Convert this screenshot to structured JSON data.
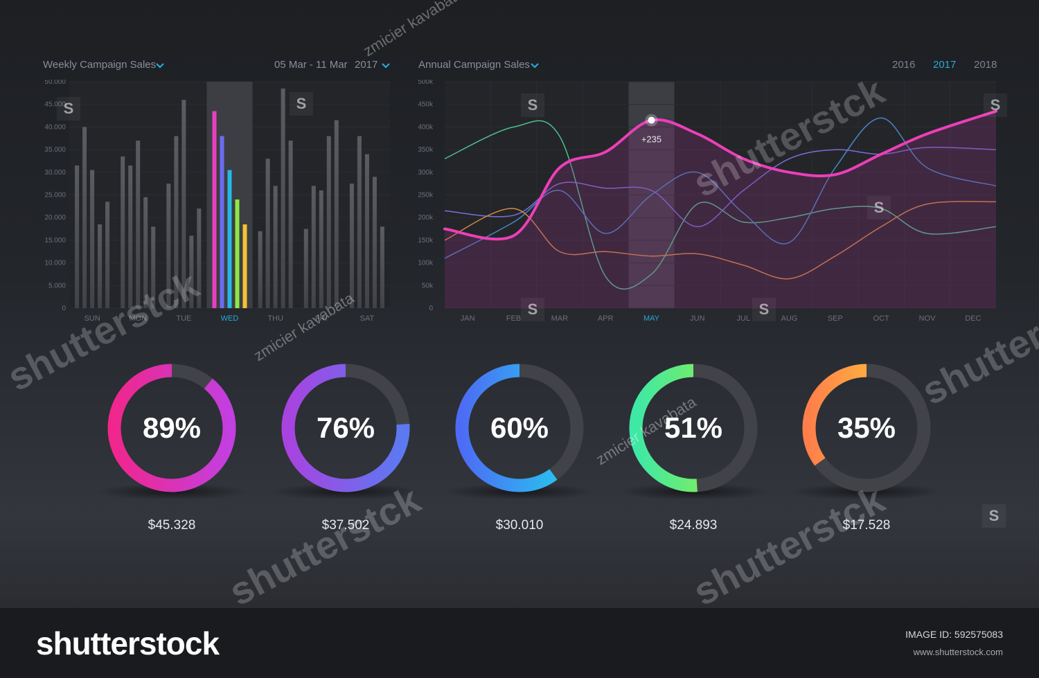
{
  "weekly": {
    "title": "Weekly Campaign Sales",
    "date_range": "05 Mar - 11 Mar",
    "year": "2017"
  },
  "annual": {
    "title": "Annual Campaign Sales",
    "years": [
      "2016",
      "2017",
      "2018"
    ],
    "active_year": "2017",
    "tooltip": "+235"
  },
  "chart_data": [
    {
      "type": "bar",
      "title": "Weekly Campaign Sales",
      "categories": [
        "SUN",
        "MON",
        "TUE",
        "WED",
        "THU",
        "FRI",
        "SAT"
      ],
      "highlighted_category": "WED",
      "yticks": [
        "0",
        "5.000",
        "10.000",
        "15.000",
        "20.000",
        "25.000",
        "30.000",
        "35.000",
        "40.000",
        "45.000",
        "50.000"
      ],
      "ylim": [
        0,
        50000
      ],
      "series": [
        {
          "values": [
            31500,
            33500,
            27500,
            43500,
            17000,
            17500,
            27500
          ]
        },
        {
          "values": [
            40000,
            31500,
            38000,
            38000,
            33000,
            27000,
            38000
          ]
        },
        {
          "values": [
            30500,
            37000,
            46000,
            30500,
            27000,
            26000,
            34000
          ]
        },
        {
          "values": [
            18500,
            24500,
            16000,
            24000,
            48500,
            38000,
            29000
          ]
        },
        {
          "values": [
            23500,
            18000,
            22000,
            18500,
            37000,
            41500,
            18000
          ]
        }
      ],
      "highlight_colors": [
        "#e83fc2",
        "#6b6cf0",
        "#26b8e6",
        "#8ee844",
        "#f5c236"
      ],
      "grid": true
    },
    {
      "type": "line",
      "title": "Annual Campaign Sales",
      "x": [
        "JAN",
        "FEB",
        "MAR",
        "APR",
        "MAY",
        "JUN",
        "JUL",
        "AUG",
        "SEP",
        "OCT",
        "NOV",
        "DEC"
      ],
      "highlighted_x": "MAY",
      "yticks": [
        "0",
        "50k",
        "100k",
        "150k",
        "200k",
        "250k",
        "300k",
        "350k",
        "400k",
        "450k",
        "500k"
      ],
      "ylim": [
        0,
        500000
      ],
      "series": [
        {
          "color": "#ec3fb8",
          "values": [
            175000,
            160000,
            310000,
            345000,
            415000,
            385000,
            330000,
            300000,
            295000,
            340000,
            385000,
            435000
          ],
          "annotation": {
            "x": "MAY",
            "label": "+235"
          }
        },
        {
          "color": "#4fc08a",
          "values": [
            330000,
            400000,
            380000,
            70000,
            75000,
            230000,
            190000,
            200000,
            220000,
            220000,
            165000,
            180000
          ]
        },
        {
          "color": "#4a86c8",
          "values": [
            110000,
            190000,
            260000,
            165000,
            250000,
            300000,
            210000,
            145000,
            310000,
            420000,
            310000,
            270000
          ]
        },
        {
          "color": "#7b6fd8",
          "values": [
            215000,
            205000,
            275000,
            265000,
            260000,
            180000,
            260000,
            330000,
            350000,
            340000,
            355000,
            350000
          ]
        },
        {
          "color": "#d98a3e",
          "values": [
            150000,
            220000,
            125000,
            125000,
            115000,
            120000,
            95000,
            65000,
            115000,
            180000,
            230000,
            235000
          ]
        }
      ],
      "grid": true
    },
    {
      "type": "pie",
      "title": "",
      "items": [
        {
          "percent": 89,
          "label": "89%",
          "amount": "$45.328",
          "colors": [
            "#f0268c",
            "#c33fe0"
          ]
        },
        {
          "percent": 76,
          "label": "76%",
          "amount": "$37.502",
          "colors": [
            "#a843e0",
            "#5b7af2"
          ]
        },
        {
          "percent": 60,
          "label": "60%",
          "amount": "$30.010",
          "colors": [
            "#4d6cf5",
            "#22d0ee"
          ]
        },
        {
          "percent": 51,
          "label": "51%",
          "amount": "$24.893",
          "colors": [
            "#3ee8a6",
            "#9ef03a"
          ]
        },
        {
          "percent": 35,
          "label": "35%",
          "amount": "$17.528",
          "colors": [
            "#ff7f4a",
            "#ffd93a"
          ]
        }
      ]
    }
  ],
  "watermark": {
    "brand": "shutterstock",
    "author": "zmicier kavabata",
    "image_id_label": "IMAGE ID: 592575083",
    "site": "www.shutterstock.com"
  },
  "colors": {
    "accent": "#2aa8d8",
    "background": "#1d1f23"
  }
}
